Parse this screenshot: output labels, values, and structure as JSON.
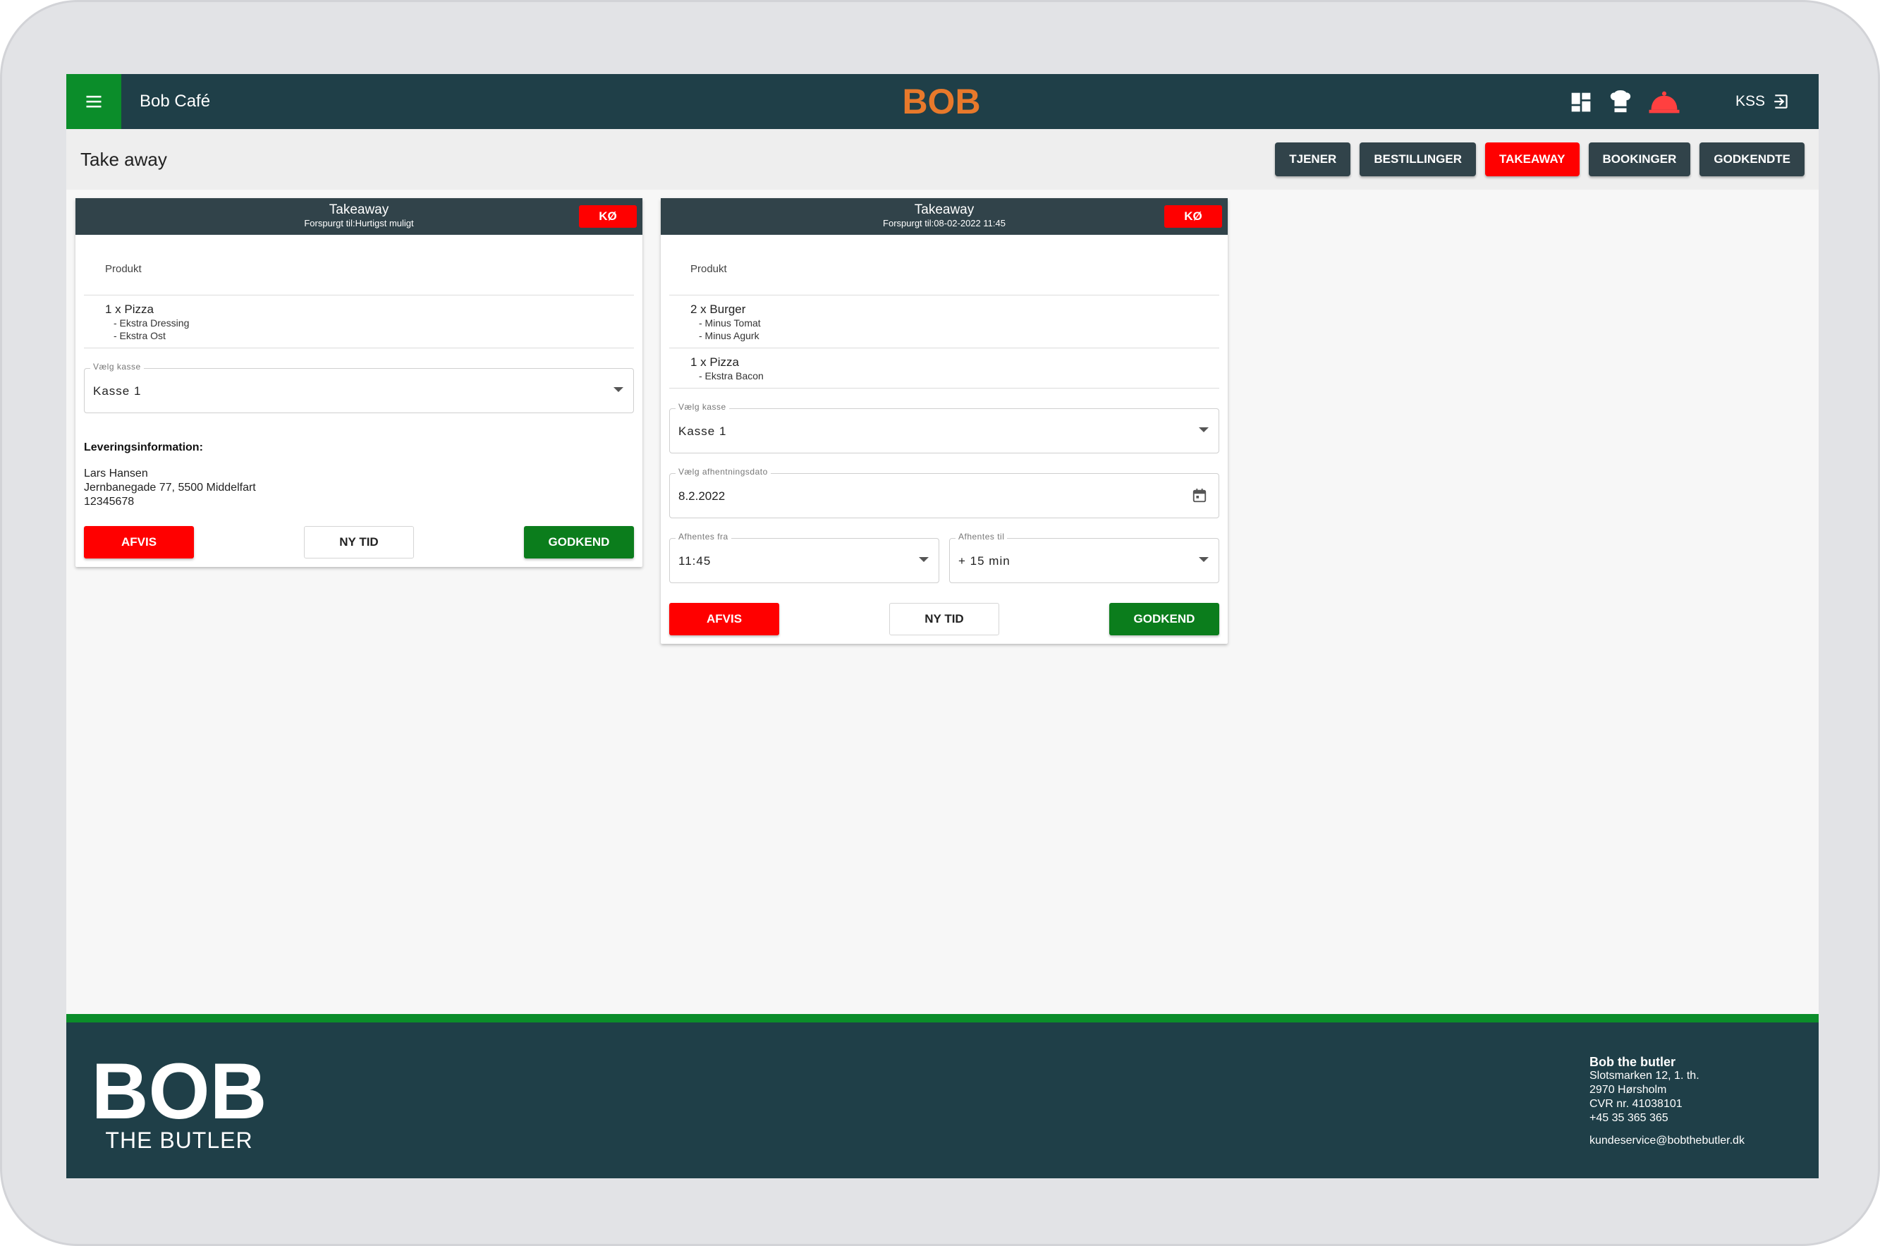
{
  "header": {
    "cafe_name": "Bob Café",
    "logo_text": "BOB",
    "user": "KSS",
    "icons": [
      "dashboard-icon",
      "chef-hat-icon",
      "service-bell-icon",
      "logout-icon"
    ],
    "brand_color": "#e8792b",
    "bar_color": "#1f3f48",
    "accent_green": "#0b8d2a"
  },
  "page": {
    "title": "Take away",
    "tabs": [
      {
        "label": "TJENER",
        "active": false
      },
      {
        "label": "BESTILLINGER",
        "active": false
      },
      {
        "label": "TAKEAWAY",
        "active": true
      },
      {
        "label": "BOOKINGER",
        "active": false
      },
      {
        "label": "GODKENDTE",
        "active": false
      }
    ]
  },
  "orders": [
    {
      "title": "Takeaway",
      "subtitle": "Forspurgt til:Hurtigst muligt",
      "queue_label": "KØ",
      "product_header": "Produkt",
      "items": [
        {
          "name": "1 x Pizza",
          "options": [
            "- Ekstra Dressing",
            "- Ekstra Ost"
          ]
        }
      ],
      "register_label": "Vælg kasse",
      "register_value": "Kasse 1",
      "delivery_heading": "Leveringsinformation:",
      "delivery_name": "Lars Hansen",
      "delivery_address": "Jernbanegade 77, 5500 Middelfart",
      "delivery_phone": "12345678",
      "reject": "AFVIS",
      "new_time": "NY TID",
      "approve": "GODKEND"
    },
    {
      "title": "Takeaway",
      "subtitle": "Forspurgt til:08-02-2022 11:45",
      "queue_label": "KØ",
      "product_header": "Produkt",
      "items": [
        {
          "name": "2 x Burger",
          "options": [
            "- Minus Tomat",
            "- Minus Agurk"
          ]
        },
        {
          "name": "1 x Pizza",
          "options": [
            "- Ekstra Bacon"
          ]
        }
      ],
      "register_label": "Vælg kasse",
      "register_value": "Kasse 1",
      "date_label": "Vælg afhentningsdato",
      "date_value": "8.2.2022",
      "from_label": "Afhentes fra",
      "from_value": "11:45",
      "to_label": "Afhentes til",
      "to_value": "+ 15 min",
      "reject": "AFVIS",
      "new_time": "NY TID",
      "approve": "GODKEND"
    }
  ],
  "footer": {
    "logo_text": "BOB",
    "logo_subtitle": "THE BUTLER",
    "company_name": "Bob the butler",
    "address_line1": "Slotsmarken 12, 1. th.",
    "address_line2": "2970 Hørsholm",
    "cvr": "CVR nr. 41038101",
    "phone": "+45 35 365 365",
    "email": "kundeservice@bobthebutler.dk"
  }
}
